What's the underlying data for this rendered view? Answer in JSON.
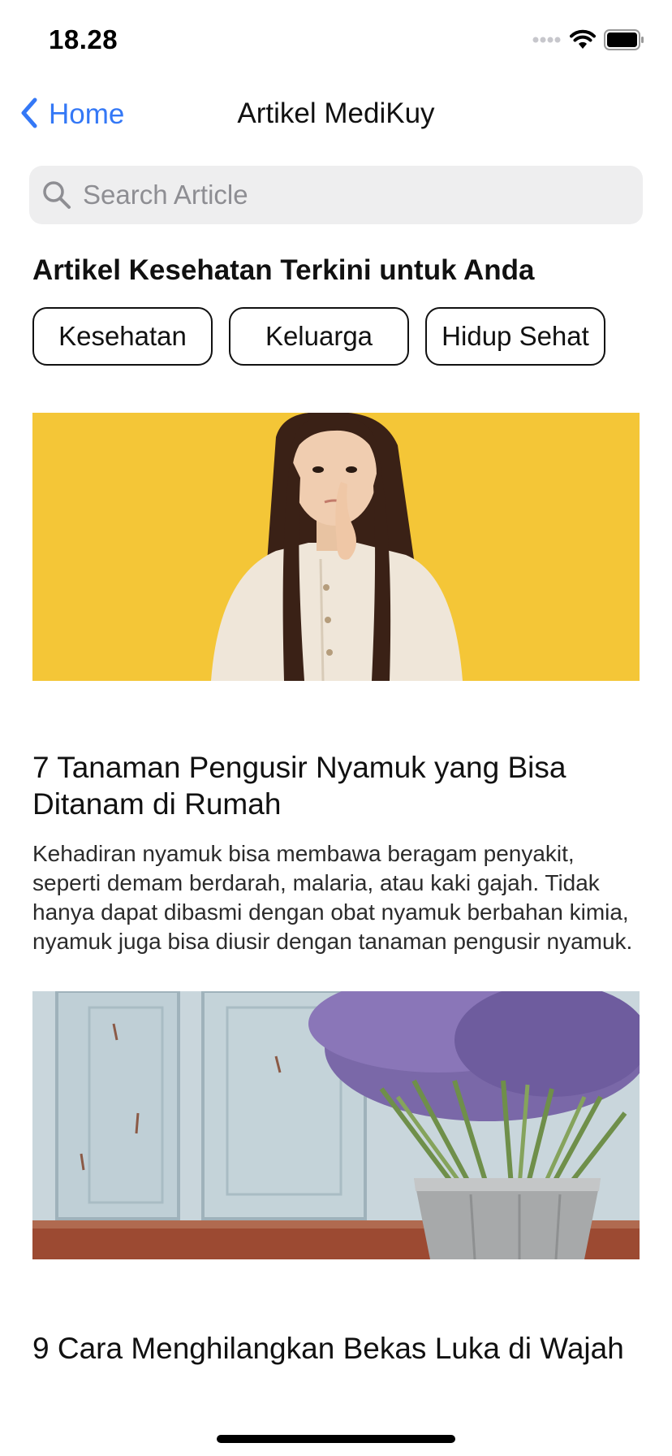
{
  "status_bar": {
    "time": "18.28",
    "icons": [
      "cellular-signal-icon",
      "wifi-icon",
      "battery-icon"
    ]
  },
  "nav": {
    "back_label": "Home",
    "title": "Artikel MediKuy",
    "accent_color": "#3478f6"
  },
  "search": {
    "placeholder": "Search Article",
    "value": ""
  },
  "section": {
    "heading": "Artikel Kesehatan Terkini untuk Anda"
  },
  "categories": [
    {
      "label": "Kesehatan"
    },
    {
      "label": "Keluarga"
    },
    {
      "label": "Hidup Sehat"
    }
  ],
  "articles": [
    {
      "image": "woman-thinking-yellow-background-photo",
      "title": "7 Tanaman Pengusir Nyamuk yang Bisa Ditanam di Rumah",
      "excerpt": "Kehadiran nyamuk bisa membawa beragam penyakit, seperti demam berdarah, malaria, atau kaki gajah. Tidak hanya dapat dibasmi dengan obat nyamuk berbahan kimia, nyamuk juga bisa diusir dengan tanaman pengusir nyamuk."
    },
    {
      "image": "lavender-bucket-photo",
      "title": "9 Cara Menghilangkan Bekas Luka di Wajah",
      "excerpt": ""
    }
  ]
}
